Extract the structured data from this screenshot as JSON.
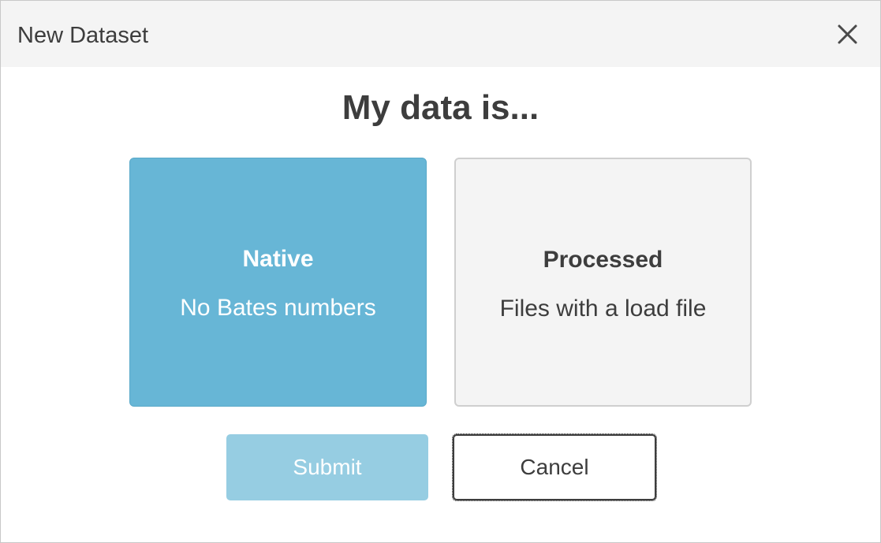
{
  "dialog": {
    "title": "New Dataset",
    "close_icon": "close-icon"
  },
  "main": {
    "heading": "My data is..."
  },
  "options": [
    {
      "title": "Native",
      "subtitle": "No Bates numbers",
      "selected": true,
      "color": "#67b6d6"
    },
    {
      "title": "Processed",
      "subtitle": "Files with a load file",
      "selected": false,
      "color": "#f4f4f4"
    }
  ],
  "buttons": {
    "submit_label": "Submit",
    "cancel_label": "Cancel"
  },
  "colors": {
    "accent": "#67b6d6",
    "submit_bg": "#96cde2",
    "text": "#3d3d3d"
  }
}
